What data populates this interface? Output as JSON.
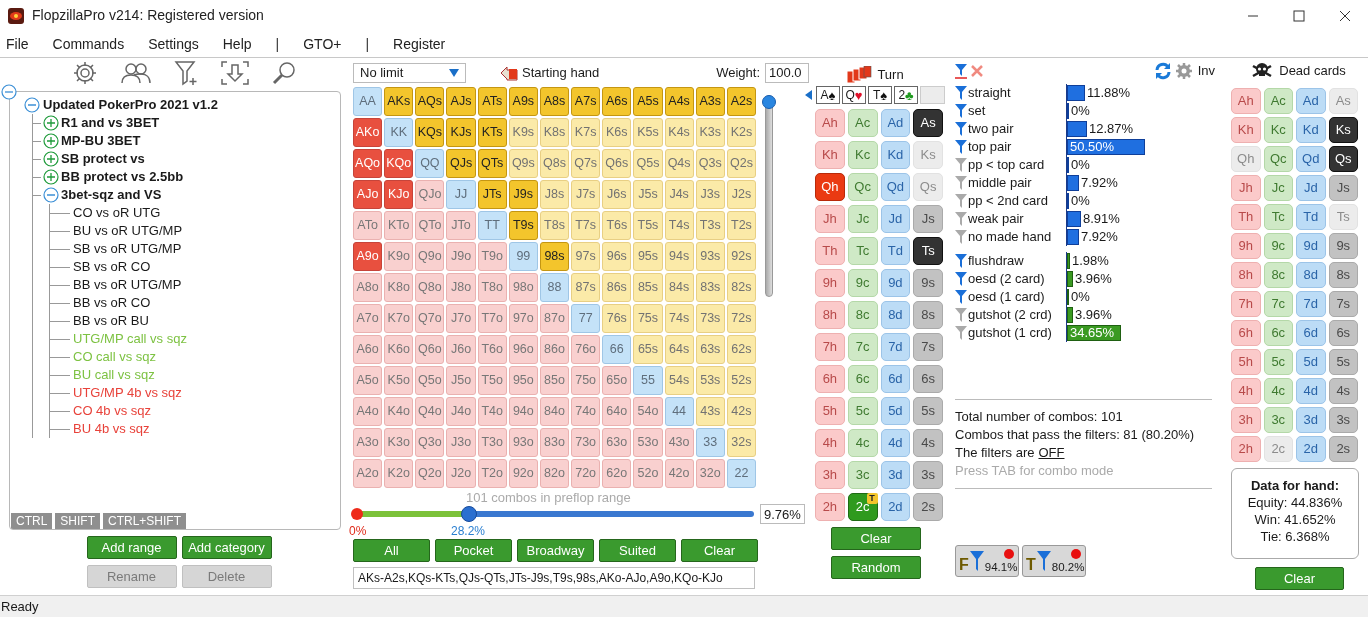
{
  "window": {
    "title": "FlopzillaPro v214: Registered version"
  },
  "menu": [
    {
      "label": "File",
      "kind": "item"
    },
    {
      "label": "Commands",
      "kind": "item"
    },
    {
      "label": "Settings",
      "kind": "item"
    },
    {
      "label": "Help",
      "kind": "item"
    },
    {
      "label": "|",
      "kind": "separator"
    },
    {
      "label": "GTO+",
      "kind": "item"
    },
    {
      "label": "|",
      "kind": "separator"
    },
    {
      "label": "Register",
      "kind": "item"
    }
  ],
  "ranges": {
    "expanded": true,
    "root": {
      "label": "Updated PokerPro 2021 v1.2",
      "expanded": true,
      "children": [
        {
          "label": "R1 and vs 3BET",
          "expanded": false
        },
        {
          "label": "MP-BU 3BET",
          "expanded": false
        },
        {
          "label": "SB protect vs",
          "expanded": false
        },
        {
          "label": "BB protect vs 2.5bb",
          "expanded": false
        },
        {
          "label": "3bet-sqz and VS",
          "expanded": true,
          "children": [
            {
              "label": "CO vs oR UTG",
              "color": "#1a1a1a"
            },
            {
              "label": "BU vs oR UTG/MP",
              "color": "#1a1a1a"
            },
            {
              "label": "SB vs oR UTG/MP",
              "color": "#1a1a1a"
            },
            {
              "label": "SB vs oR CO",
              "color": "#1a1a1a"
            },
            {
              "label": "BB vs oR UTG/MP",
              "color": "#1a1a1a"
            },
            {
              "label": "BB vs oR CO",
              "color": "#1a1a1a"
            },
            {
              "label": "BB vs oR BU",
              "color": "#1a1a1a"
            },
            {
              "label": "UTG/MP call vs sqz",
              "color": "#7dc242"
            },
            {
              "label": "CO call vs sqz",
              "color": "#7dc242"
            },
            {
              "label": "BU call vs sqz",
              "color": "#7dc242"
            },
            {
              "label": "UTG/MP 4b vs sqz",
              "color": "#e8423a"
            },
            {
              "label": "CO 4b vs sqz",
              "color": "#e8423a"
            },
            {
              "label": "BU 4b vs sqz",
              "color": "#e8423a"
            }
          ]
        }
      ]
    },
    "modifier_tabs": [
      "CTRL",
      "SHIFT",
      "CTRL+SHIFT"
    ],
    "buttons": [
      {
        "label": "Add range",
        "disabled": false
      },
      {
        "label": "Add category",
        "disabled": false
      },
      {
        "label": "Rename",
        "disabled": true
      },
      {
        "label": "Delete",
        "disabled": true
      }
    ]
  },
  "game_select": {
    "value": "No limit"
  },
  "starting_hand": {
    "label": "Starting hand"
  },
  "weight": {
    "label": "Weight:",
    "value": "100.0",
    "level": 1
  },
  "matrix": [
    [
      {
        "label": "AA",
        "kind": "pair",
        "selected": false
      },
      {
        "label": "AKs",
        "kind": "suited",
        "selected": true
      },
      {
        "label": "AQs",
        "kind": "suited",
        "selected": true
      },
      {
        "label": "AJs",
        "kind": "suited",
        "selected": true
      },
      {
        "label": "ATs",
        "kind": "suited",
        "selected": true
      },
      {
        "label": "A9s",
        "kind": "suited",
        "selected": true
      },
      {
        "label": "A8s",
        "kind": "suited",
        "selected": true
      },
      {
        "label": "A7s",
        "kind": "suited",
        "selected": true
      },
      {
        "label": "A6s",
        "kind": "suited",
        "selected": true
      },
      {
        "label": "A5s",
        "kind": "suited",
        "selected": true
      },
      {
        "label": "A4s",
        "kind": "suited",
        "selected": true
      },
      {
        "label": "A3s",
        "kind": "suited",
        "selected": true
      },
      {
        "label": "A2s",
        "kind": "suited",
        "selected": true
      }
    ],
    [
      {
        "label": "AKo",
        "kind": "offsuit",
        "selected": true
      },
      {
        "label": "KK",
        "kind": "pair",
        "selected": false
      },
      {
        "label": "KQs",
        "kind": "suited",
        "selected": true
      },
      {
        "label": "KJs",
        "kind": "suited",
        "selected": true
      },
      {
        "label": "KTs",
        "kind": "suited",
        "selected": true
      },
      {
        "label": "K9s",
        "kind": "suited",
        "selected": false
      },
      {
        "label": "K8s",
        "kind": "suited",
        "selected": false
      },
      {
        "label": "K7s",
        "kind": "suited",
        "selected": false
      },
      {
        "label": "K6s",
        "kind": "suited",
        "selected": false
      },
      {
        "label": "K5s",
        "kind": "suited",
        "selected": false
      },
      {
        "label": "K4s",
        "kind": "suited",
        "selected": false
      },
      {
        "label": "K3s",
        "kind": "suited",
        "selected": false
      },
      {
        "label": "K2s",
        "kind": "suited",
        "selected": false
      }
    ],
    [
      {
        "label": "AQo",
        "kind": "offsuit",
        "selected": true
      },
      {
        "label": "KQo",
        "kind": "offsuit",
        "selected": true
      },
      {
        "label": "QQ",
        "kind": "pair",
        "selected": false
      },
      {
        "label": "QJs",
        "kind": "suited",
        "selected": true
      },
      {
        "label": "QTs",
        "kind": "suited",
        "selected": true
      },
      {
        "label": "Q9s",
        "kind": "suited",
        "selected": false
      },
      {
        "label": "Q8s",
        "kind": "suited",
        "selected": false
      },
      {
        "label": "Q7s",
        "kind": "suited",
        "selected": false
      },
      {
        "label": "Q6s",
        "kind": "suited",
        "selected": false
      },
      {
        "label": "Q5s",
        "kind": "suited",
        "selected": false
      },
      {
        "label": "Q4s",
        "kind": "suited",
        "selected": false
      },
      {
        "label": "Q3s",
        "kind": "suited",
        "selected": false
      },
      {
        "label": "Q2s",
        "kind": "suited",
        "selected": false
      }
    ],
    [
      {
        "label": "AJo",
        "kind": "offsuit",
        "selected": true
      },
      {
        "label": "KJo",
        "kind": "offsuit",
        "selected": true
      },
      {
        "label": "QJo",
        "kind": "offsuit",
        "selected": false
      },
      {
        "label": "JJ",
        "kind": "pair",
        "selected": false
      },
      {
        "label": "JTs",
        "kind": "suited",
        "selected": true
      },
      {
        "label": "J9s",
        "kind": "suited",
        "selected": true
      },
      {
        "label": "J8s",
        "kind": "suited",
        "selected": false
      },
      {
        "label": "J7s",
        "kind": "suited",
        "selected": false
      },
      {
        "label": "J6s",
        "kind": "suited",
        "selected": false
      },
      {
        "label": "J5s",
        "kind": "suited",
        "selected": false
      },
      {
        "label": "J4s",
        "kind": "suited",
        "selected": false
      },
      {
        "label": "J3s",
        "kind": "suited",
        "selected": false
      },
      {
        "label": "J2s",
        "kind": "suited",
        "selected": false
      }
    ],
    [
      {
        "label": "ATo",
        "kind": "offsuit",
        "selected": false
      },
      {
        "label": "KTo",
        "kind": "offsuit",
        "selected": false
      },
      {
        "label": "QTo",
        "kind": "offsuit",
        "selected": false
      },
      {
        "label": "JTo",
        "kind": "offsuit",
        "selected": false
      },
      {
        "label": "TT",
        "kind": "pair",
        "selected": false
      },
      {
        "label": "T9s",
        "kind": "suited",
        "selected": true
      },
      {
        "label": "T8s",
        "kind": "suited",
        "selected": false
      },
      {
        "label": "T7s",
        "kind": "suited",
        "selected": false
      },
      {
        "label": "T6s",
        "kind": "suited",
        "selected": false
      },
      {
        "label": "T5s",
        "kind": "suited",
        "selected": false
      },
      {
        "label": "T4s",
        "kind": "suited",
        "selected": false
      },
      {
        "label": "T3s",
        "kind": "suited",
        "selected": false
      },
      {
        "label": "T2s",
        "kind": "suited",
        "selected": false
      }
    ],
    [
      {
        "label": "A9o",
        "kind": "offsuit",
        "selected": true
      },
      {
        "label": "K9o",
        "kind": "offsuit",
        "selected": false
      },
      {
        "label": "Q9o",
        "kind": "offsuit",
        "selected": false
      },
      {
        "label": "J9o",
        "kind": "offsuit",
        "selected": false
      },
      {
        "label": "T9o",
        "kind": "offsuit",
        "selected": false
      },
      {
        "label": "99",
        "kind": "pair",
        "selected": false
      },
      {
        "label": "98s",
        "kind": "suited",
        "selected": true
      },
      {
        "label": "97s",
        "kind": "suited",
        "selected": false
      },
      {
        "label": "96s",
        "kind": "suited",
        "selected": false
      },
      {
        "label": "95s",
        "kind": "suited",
        "selected": false
      },
      {
        "label": "94s",
        "kind": "suited",
        "selected": false
      },
      {
        "label": "93s",
        "kind": "suited",
        "selected": false
      },
      {
        "label": "92s",
        "kind": "suited",
        "selected": false
      }
    ],
    [
      {
        "label": "A8o",
        "kind": "offsuit",
        "selected": false
      },
      {
        "label": "K8o",
        "kind": "offsuit",
        "selected": false
      },
      {
        "label": "Q8o",
        "kind": "offsuit",
        "selected": false
      },
      {
        "label": "J8o",
        "kind": "offsuit",
        "selected": false
      },
      {
        "label": "T8o",
        "kind": "offsuit",
        "selected": false
      },
      {
        "label": "98o",
        "kind": "offsuit",
        "selected": false
      },
      {
        "label": "88",
        "kind": "pair",
        "selected": false
      },
      {
        "label": "87s",
        "kind": "suited",
        "selected": false
      },
      {
        "label": "86s",
        "kind": "suited",
        "selected": false
      },
      {
        "label": "85s",
        "kind": "suited",
        "selected": false
      },
      {
        "label": "84s",
        "kind": "suited",
        "selected": false
      },
      {
        "label": "83s",
        "kind": "suited",
        "selected": false
      },
      {
        "label": "82s",
        "kind": "suited",
        "selected": false
      }
    ],
    [
      {
        "label": "A7o",
        "kind": "offsuit",
        "selected": false
      },
      {
        "label": "K7o",
        "kind": "offsuit",
        "selected": false
      },
      {
        "label": "Q7o",
        "kind": "offsuit",
        "selected": false
      },
      {
        "label": "J7o",
        "kind": "offsuit",
        "selected": false
      },
      {
        "label": "T7o",
        "kind": "offsuit",
        "selected": false
      },
      {
        "label": "97o",
        "kind": "offsuit",
        "selected": false
      },
      {
        "label": "87o",
        "kind": "offsuit",
        "selected": false
      },
      {
        "label": "77",
        "kind": "pair",
        "selected": false
      },
      {
        "label": "76s",
        "kind": "suited",
        "selected": false
      },
      {
        "label": "75s",
        "kind": "suited",
        "selected": false
      },
      {
        "label": "74s",
        "kind": "suited",
        "selected": false
      },
      {
        "label": "73s",
        "kind": "suited",
        "selected": false
      },
      {
        "label": "72s",
        "kind": "suited",
        "selected": false
      }
    ],
    [
      {
        "label": "A6o",
        "kind": "offsuit",
        "selected": false
      },
      {
        "label": "K6o",
        "kind": "offsuit",
        "selected": false
      },
      {
        "label": "Q6o",
        "kind": "offsuit",
        "selected": false
      },
      {
        "label": "J6o",
        "kind": "offsuit",
        "selected": false
      },
      {
        "label": "T6o",
        "kind": "offsuit",
        "selected": false
      },
      {
        "label": "96o",
        "kind": "offsuit",
        "selected": false
      },
      {
        "label": "86o",
        "kind": "offsuit",
        "selected": false
      },
      {
        "label": "76o",
        "kind": "offsuit",
        "selected": false
      },
      {
        "label": "66",
        "kind": "pair",
        "selected": false
      },
      {
        "label": "65s",
        "kind": "suited",
        "selected": false
      },
      {
        "label": "64s",
        "kind": "suited",
        "selected": false
      },
      {
        "label": "63s",
        "kind": "suited",
        "selected": false
      },
      {
        "label": "62s",
        "kind": "suited",
        "selected": false
      }
    ],
    [
      {
        "label": "A5o",
        "kind": "offsuit",
        "selected": false
      },
      {
        "label": "K5o",
        "kind": "offsuit",
        "selected": false
      },
      {
        "label": "Q5o",
        "kind": "offsuit",
        "selected": false
      },
      {
        "label": "J5o",
        "kind": "offsuit",
        "selected": false
      },
      {
        "label": "T5o",
        "kind": "offsuit",
        "selected": false
      },
      {
        "label": "95o",
        "kind": "offsuit",
        "selected": false
      },
      {
        "label": "85o",
        "kind": "offsuit",
        "selected": false
      },
      {
        "label": "75o",
        "kind": "offsuit",
        "selected": false
      },
      {
        "label": "65o",
        "kind": "offsuit",
        "selected": false
      },
      {
        "label": "55",
        "kind": "pair",
        "selected": false
      },
      {
        "label": "54s",
        "kind": "suited",
        "selected": false
      },
      {
        "label": "53s",
        "kind": "suited",
        "selected": false
      },
      {
        "label": "52s",
        "kind": "suited",
        "selected": false
      }
    ],
    [
      {
        "label": "A4o",
        "kind": "offsuit",
        "selected": false
      },
      {
        "label": "K4o",
        "kind": "offsuit",
        "selected": false
      },
      {
        "label": "Q4o",
        "kind": "offsuit",
        "selected": false
      },
      {
        "label": "J4o",
        "kind": "offsuit",
        "selected": false
      },
      {
        "label": "T4o",
        "kind": "offsuit",
        "selected": false
      },
      {
        "label": "94o",
        "kind": "offsuit",
        "selected": false
      },
      {
        "label": "84o",
        "kind": "offsuit",
        "selected": false
      },
      {
        "label": "74o",
        "kind": "offsuit",
        "selected": false
      },
      {
        "label": "64o",
        "kind": "offsuit",
        "selected": false
      },
      {
        "label": "54o",
        "kind": "offsuit",
        "selected": false
      },
      {
        "label": "44",
        "kind": "pair",
        "selected": false
      },
      {
        "label": "43s",
        "kind": "suited",
        "selected": false
      },
      {
        "label": "42s",
        "kind": "suited",
        "selected": false
      }
    ],
    [
      {
        "label": "A3o",
        "kind": "offsuit",
        "selected": false
      },
      {
        "label": "K3o",
        "kind": "offsuit",
        "selected": false
      },
      {
        "label": "Q3o",
        "kind": "offsuit",
        "selected": false
      },
      {
        "label": "J3o",
        "kind": "offsuit",
        "selected": false
      },
      {
        "label": "T3o",
        "kind": "offsuit",
        "selected": false
      },
      {
        "label": "93o",
        "kind": "offsuit",
        "selected": false
      },
      {
        "label": "83o",
        "kind": "offsuit",
        "selected": false
      },
      {
        "label": "73o",
        "kind": "offsuit",
        "selected": false
      },
      {
        "label": "63o",
        "kind": "offsuit",
        "selected": false
      },
      {
        "label": "53o",
        "kind": "offsuit",
        "selected": false
      },
      {
        "label": "43o",
        "kind": "offsuit",
        "selected": false
      },
      {
        "label": "33",
        "kind": "pair",
        "selected": false
      },
      {
        "label": "32s",
        "kind": "suited",
        "selected": false
      }
    ],
    [
      {
        "label": "A2o",
        "kind": "offsuit",
        "selected": false
      },
      {
        "label": "K2o",
        "kind": "offsuit",
        "selected": false
      },
      {
        "label": "Q2o",
        "kind": "offsuit",
        "selected": false
      },
      {
        "label": "J2o",
        "kind": "offsuit",
        "selected": false
      },
      {
        "label": "T2o",
        "kind": "offsuit",
        "selected": false
      },
      {
        "label": "92o",
        "kind": "offsuit",
        "selected": false
      },
      {
        "label": "82o",
        "kind": "offsuit",
        "selected": false
      },
      {
        "label": "72o",
        "kind": "offsuit",
        "selected": false
      },
      {
        "label": "62o",
        "kind": "offsuit",
        "selected": false
      },
      {
        "label": "52o",
        "kind": "offsuit",
        "selected": false
      },
      {
        "label": "42o",
        "kind": "offsuit",
        "selected": false
      },
      {
        "label": "32o",
        "kind": "offsuit",
        "selected": false
      },
      {
        "label": "22",
        "kind": "pair",
        "selected": false
      }
    ]
  ],
  "combos_text": "101 combos in preflop range",
  "range_slider": {
    "low": {
      "label": "0%",
      "level": 0
    },
    "high": {
      "label": "28.2%",
      "level": 0.282
    },
    "percent": "9.76%"
  },
  "range_buttons": [
    "All",
    "Pocket",
    "Broadway",
    "Suited",
    "Clear"
  ],
  "range_text": "AKs-A2s,KQs-KTs,QJs-QTs,JTs-J9s,T9s,98s,AKo-AJo,A9o,KQo-KJo",
  "board": {
    "title": "Turn",
    "slots": [
      {
        "kind": "card",
        "rank": "A",
        "suit": "♠",
        "color": "#111111"
      },
      {
        "kind": "card",
        "rank": "Q",
        "suit": "♥",
        "color": "#e0102a"
      },
      {
        "kind": "card",
        "rank": "T",
        "suit": "♠",
        "color": "#111111"
      },
      {
        "kind": "card",
        "rank": "2",
        "suit": "♣",
        "color": "#1f9a1f"
      },
      {
        "kind": "empty"
      }
    ],
    "columns": [
      {
        "kind": "hearts",
        "cards": [
          {
            "label": "Ah",
            "picked": false,
            "unavailable": false
          },
          {
            "label": "Kh",
            "picked": false,
            "unavailable": false
          },
          {
            "label": "Qh",
            "picked": true,
            "unavailable": false
          },
          {
            "label": "Jh",
            "picked": false,
            "unavailable": false
          },
          {
            "label": "Th",
            "picked": false,
            "unavailable": false
          },
          {
            "label": "9h",
            "picked": false,
            "unavailable": false
          },
          {
            "label": "8h",
            "picked": false,
            "unavailable": false
          },
          {
            "label": "7h",
            "picked": false,
            "unavailable": false
          },
          {
            "label": "6h",
            "picked": false,
            "unavailable": false
          },
          {
            "label": "5h",
            "picked": false,
            "unavailable": false
          },
          {
            "label": "4h",
            "picked": false,
            "unavailable": false
          },
          {
            "label": "3h",
            "picked": false,
            "unavailable": false
          },
          {
            "label": "2h",
            "picked": false,
            "unavailable": false
          }
        ]
      },
      {
        "kind": "clubs",
        "cards": [
          {
            "label": "Ac",
            "picked": false,
            "unavailable": false
          },
          {
            "label": "Kc",
            "picked": false,
            "unavailable": false
          },
          {
            "label": "Qc",
            "picked": false,
            "unavailable": false
          },
          {
            "label": "Jc",
            "picked": false,
            "unavailable": false
          },
          {
            "label": "Tc",
            "picked": false,
            "unavailable": false
          },
          {
            "label": "9c",
            "picked": false,
            "unavailable": false
          },
          {
            "label": "8c",
            "picked": false,
            "unavailable": false
          },
          {
            "label": "7c",
            "picked": false,
            "unavailable": false
          },
          {
            "label": "6c",
            "picked": false,
            "unavailable": false
          },
          {
            "label": "5c",
            "picked": false,
            "unavailable": false
          },
          {
            "label": "4c",
            "picked": false,
            "unavailable": false
          },
          {
            "label": "3c",
            "picked": false,
            "unavailable": false
          },
          {
            "label": "2c",
            "picked": true,
            "unavailable": false,
            "badge": "T"
          }
        ]
      },
      {
        "kind": "diamonds",
        "cards": [
          {
            "label": "Ad",
            "picked": false,
            "unavailable": false
          },
          {
            "label": "Kd",
            "picked": false,
            "unavailable": false
          },
          {
            "label": "Qd",
            "picked": false,
            "unavailable": false
          },
          {
            "label": "Jd",
            "picked": false,
            "unavailable": false
          },
          {
            "label": "Td",
            "picked": false,
            "unavailable": false
          },
          {
            "label": "9d",
            "picked": false,
            "unavailable": false
          },
          {
            "label": "8d",
            "picked": false,
            "unavailable": false
          },
          {
            "label": "7d",
            "picked": false,
            "unavailable": false
          },
          {
            "label": "6d",
            "picked": false,
            "unavailable": false
          },
          {
            "label": "5d",
            "picked": false,
            "unavailable": false
          },
          {
            "label": "4d",
            "picked": false,
            "unavailable": false
          },
          {
            "label": "3d",
            "picked": false,
            "unavailable": false
          },
          {
            "label": "2d",
            "picked": false,
            "unavailable": false
          }
        ]
      },
      {
        "kind": "spades",
        "cards": [
          {
            "label": "As",
            "picked": true,
            "unavailable": false
          },
          {
            "label": "Ks",
            "picked": false,
            "unavailable": true
          },
          {
            "label": "Qs",
            "picked": false,
            "unavailable": true
          },
          {
            "label": "Js",
            "picked": false,
            "unavailable": false
          },
          {
            "label": "Ts",
            "picked": true,
            "unavailable": false
          },
          {
            "label": "9s",
            "picked": false,
            "unavailable": false
          },
          {
            "label": "8s",
            "picked": false,
            "unavailable": false
          },
          {
            "label": "7s",
            "picked": false,
            "unavailable": false
          },
          {
            "label": "6s",
            "picked": false,
            "unavailable": false
          },
          {
            "label": "5s",
            "picked": false,
            "unavailable": false
          },
          {
            "label": "4s",
            "picked": false,
            "unavailable": false
          },
          {
            "label": "3s",
            "picked": false,
            "unavailable": false
          },
          {
            "label": "2s",
            "picked": false,
            "unavailable": false
          }
        ]
      }
    ],
    "buttons": [
      "Clear",
      "Random"
    ]
  },
  "stats": {
    "inv_label": "Inv",
    "made": [
      {
        "label": "straight",
        "active": true,
        "value": "11.88%",
        "level": 0.1188
      },
      {
        "label": "set",
        "active": true,
        "value": "0%",
        "level": 0
      },
      {
        "label": "two pair",
        "active": true,
        "value": "12.87%",
        "level": 0.1287
      },
      {
        "label": "top pair",
        "active": true,
        "value": "50.50%",
        "level": 0.505
      },
      {
        "label": "pp < top card",
        "active": false,
        "value": "0%",
        "level": 0
      },
      {
        "label": "middle pair",
        "active": false,
        "value": "7.92%",
        "level": 0.0792
      },
      {
        "label": "pp < 2nd card",
        "active": false,
        "value": "0%",
        "level": 0
      },
      {
        "label": "weak pair",
        "active": false,
        "value": "8.91%",
        "level": 0.0891
      },
      {
        "label": "no made hand",
        "active": false,
        "value": "7.92%",
        "level": 0.0792
      }
    ],
    "draws": [
      {
        "label": "flushdraw",
        "active": true,
        "value": "1.98%",
        "level": 0.0198
      },
      {
        "label": "oesd (2 card)",
        "active": true,
        "value": "3.96%",
        "level": 0.0396
      },
      {
        "label": "oesd (1 card)",
        "active": true,
        "value": "0%",
        "level": 0
      },
      {
        "label": "gutshot (2 crd)",
        "active": false,
        "value": "3.96%",
        "level": 0.0396
      },
      {
        "label": "gutshot (1 crd)",
        "active": false,
        "value": "34.65%",
        "level": 0.3465
      }
    ]
  },
  "summary": {
    "total": "Total number of combos: 101",
    "pass": "Combos that pass the filters: 81 (80.20%)",
    "filters_label": "The filters are",
    "filters_state": "OFF",
    "hint": "Press TAB for combo mode"
  },
  "filter_buttons": [
    {
      "letter": "F",
      "value": "94.1%"
    },
    {
      "letter": "T",
      "value": "80.2%"
    }
  ],
  "dead_cards": {
    "title": "Dead cards",
    "columns": [
      {
        "kind": "hearts",
        "cards": [
          {
            "label": "Ah",
            "picked": false,
            "unavailable": false
          },
          {
            "label": "Kh",
            "picked": false,
            "unavailable": false
          },
          {
            "label": "Qh",
            "picked": false,
            "unavailable": true
          },
          {
            "label": "Jh",
            "picked": false,
            "unavailable": false
          },
          {
            "label": "Th",
            "picked": false,
            "unavailable": false
          },
          {
            "label": "9h",
            "picked": false,
            "unavailable": false
          },
          {
            "label": "8h",
            "picked": false,
            "unavailable": false
          },
          {
            "label": "7h",
            "picked": false,
            "unavailable": false
          },
          {
            "label": "6h",
            "picked": false,
            "unavailable": false
          },
          {
            "label": "5h",
            "picked": false,
            "unavailable": false
          },
          {
            "label": "4h",
            "picked": false,
            "unavailable": false
          },
          {
            "label": "3h",
            "picked": false,
            "unavailable": false
          },
          {
            "label": "2h",
            "picked": false,
            "unavailable": false
          }
        ]
      },
      {
        "kind": "clubs",
        "cards": [
          {
            "label": "Ac",
            "picked": false,
            "unavailable": false
          },
          {
            "label": "Kc",
            "picked": false,
            "unavailable": false
          },
          {
            "label": "Qc",
            "picked": false,
            "unavailable": false
          },
          {
            "label": "Jc",
            "picked": false,
            "unavailable": false
          },
          {
            "label": "Tc",
            "picked": false,
            "unavailable": false
          },
          {
            "label": "9c",
            "picked": false,
            "unavailable": false
          },
          {
            "label": "8c",
            "picked": false,
            "unavailable": false
          },
          {
            "label": "7c",
            "picked": false,
            "unavailable": false
          },
          {
            "label": "6c",
            "picked": false,
            "unavailable": false
          },
          {
            "label": "5c",
            "picked": false,
            "unavailable": false
          },
          {
            "label": "4c",
            "picked": false,
            "unavailable": false
          },
          {
            "label": "3c",
            "picked": false,
            "unavailable": false
          },
          {
            "label": "2c",
            "picked": false,
            "unavailable": true
          }
        ]
      },
      {
        "kind": "diamonds",
        "cards": [
          {
            "label": "Ad",
            "picked": false,
            "unavailable": false
          },
          {
            "label": "Kd",
            "picked": false,
            "unavailable": false
          },
          {
            "label": "Qd",
            "picked": false,
            "unavailable": false
          },
          {
            "label": "Jd",
            "picked": false,
            "unavailable": false
          },
          {
            "label": "Td",
            "picked": false,
            "unavailable": false
          },
          {
            "label": "9d",
            "picked": false,
            "unavailable": false
          },
          {
            "label": "8d",
            "picked": false,
            "unavailable": false
          },
          {
            "label": "7d",
            "picked": false,
            "unavailable": false
          },
          {
            "label": "6d",
            "picked": false,
            "unavailable": false
          },
          {
            "label": "5d",
            "picked": false,
            "unavailable": false
          },
          {
            "label": "4d",
            "picked": false,
            "unavailable": false
          },
          {
            "label": "3d",
            "picked": false,
            "unavailable": false
          },
          {
            "label": "2d",
            "picked": false,
            "unavailable": false
          }
        ]
      },
      {
        "kind": "spades",
        "cards": [
          {
            "label": "As",
            "picked": false,
            "unavailable": true
          },
          {
            "label": "Ks",
            "picked": true,
            "unavailable": false
          },
          {
            "label": "Qs",
            "picked": true,
            "unavailable": false
          },
          {
            "label": "Js",
            "picked": false,
            "unavailable": false
          },
          {
            "label": "Ts",
            "picked": false,
            "unavailable": true
          },
          {
            "label": "9s",
            "picked": false,
            "unavailable": false
          },
          {
            "label": "8s",
            "picked": false,
            "unavailable": false
          },
          {
            "label": "7s",
            "picked": false,
            "unavailable": false
          },
          {
            "label": "6s",
            "picked": false,
            "unavailable": false
          },
          {
            "label": "5s",
            "picked": false,
            "unavailable": false
          },
          {
            "label": "4s",
            "picked": false,
            "unavailable": false
          },
          {
            "label": "3s",
            "picked": false,
            "unavailable": false
          },
          {
            "label": "2s",
            "picked": false,
            "unavailable": false
          }
        ]
      }
    ],
    "hand_data": {
      "title": "Data for hand:",
      "lines": [
        "Equity: 44.836%",
        "Win: 41.652%",
        "Tie: 6.368%"
      ]
    },
    "button": "Clear"
  },
  "status_bar": {
    "text": "Ready"
  }
}
